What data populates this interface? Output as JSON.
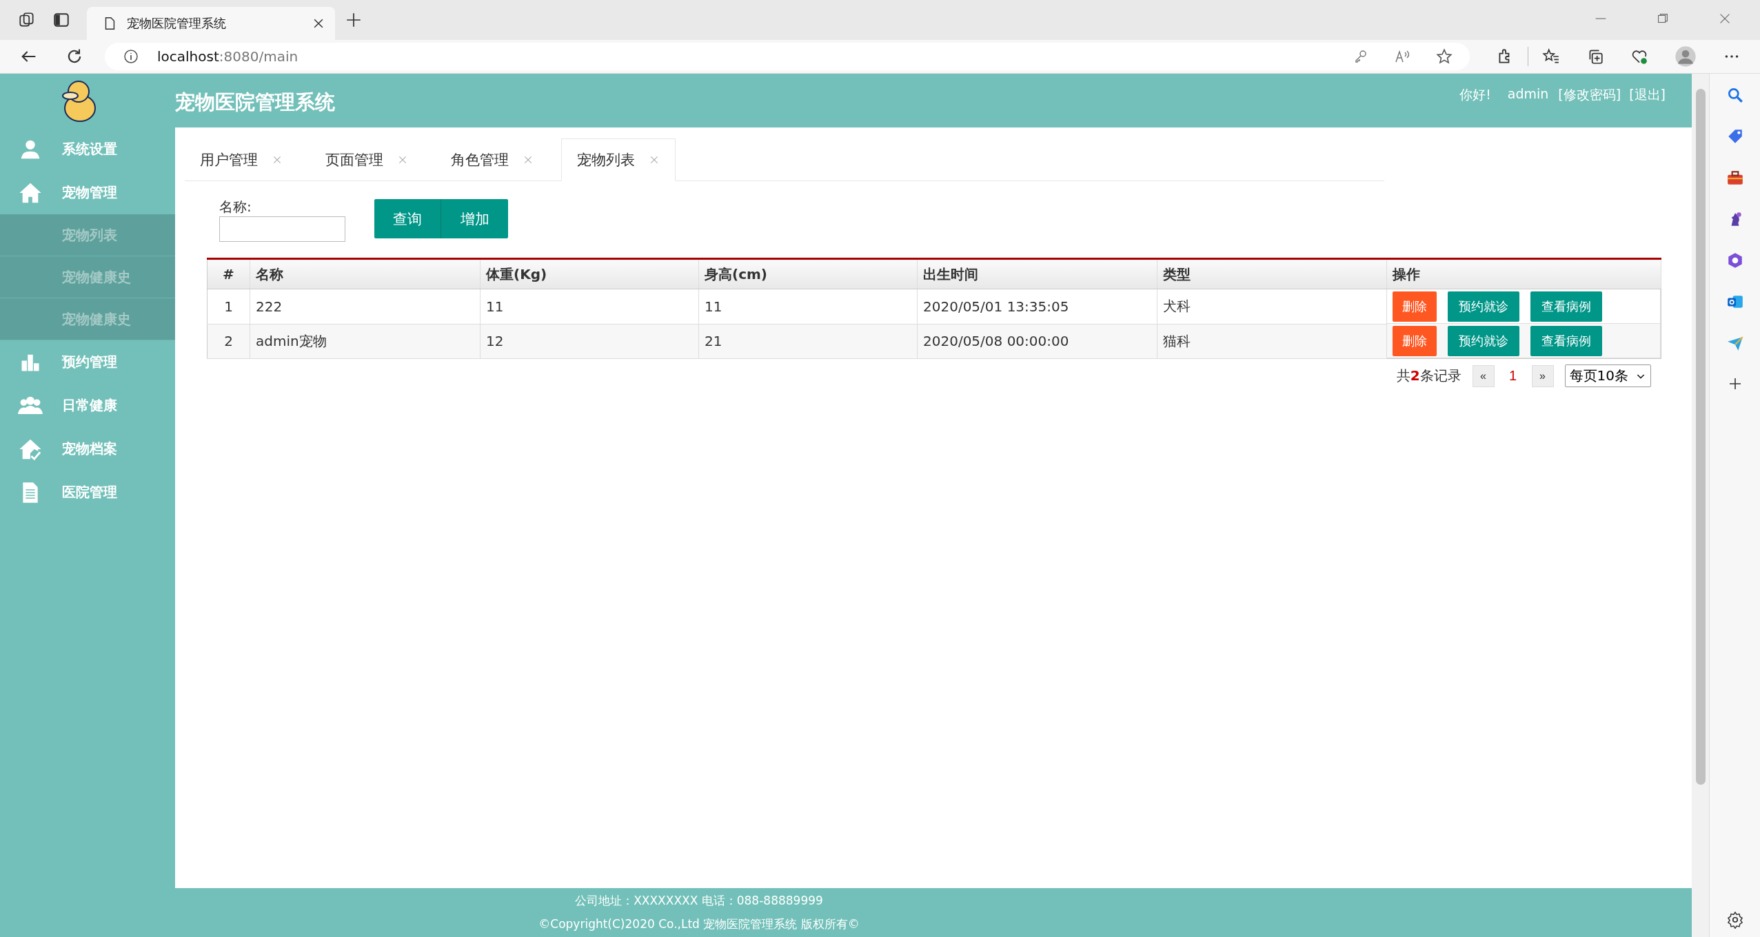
{
  "browser": {
    "tab_title": "宠物医院管理系统",
    "url_host": "localhost",
    "url_path": ":8080/main"
  },
  "header": {
    "title": "宠物医院管理系统",
    "greeting": "你好!",
    "user": "admin",
    "links": [
      "[修改密码]",
      "[退出]"
    ]
  },
  "sidebar": {
    "items": [
      {
        "label": "系统设置"
      },
      {
        "label": "宠物管理",
        "children": [
          {
            "label": "宠物列表"
          },
          {
            "label": "宠物健康史"
          },
          {
            "label": "宠物健康史"
          }
        ]
      },
      {
        "label": "预约管理"
      },
      {
        "label": "日常健康"
      },
      {
        "label": "宠物档案"
      },
      {
        "label": "医院管理"
      }
    ]
  },
  "tabs": [
    {
      "label": "用户管理",
      "selected": false
    },
    {
      "label": "页面管理",
      "selected": false
    },
    {
      "label": "角色管理",
      "selected": false
    },
    {
      "label": "宠物列表",
      "selected": true
    }
  ],
  "search": {
    "label": "名称:",
    "buttons": [
      "查询",
      "增加"
    ]
  },
  "table": {
    "columns": [
      "#",
      "名称",
      "体重(Kg)",
      "身高(cm)",
      "出生时间",
      "类型",
      "操作"
    ],
    "rows": [
      {
        "cells": [
          "1",
          "222",
          "11",
          "11",
          "2020/05/01 13:35:05",
          "犬科"
        ],
        "actions": [
          {
            "label": "删除",
            "kind": "danger"
          },
          {
            "label": "预约就诊",
            "kind": "primary"
          },
          {
            "label": "查看病例",
            "kind": "primary"
          }
        ]
      },
      {
        "cells": [
          "2",
          "admin宠物",
          "12",
          "21",
          "2020/05/08 00:00:00",
          "猫科"
        ],
        "actions": [
          {
            "label": "删除",
            "kind": "danger"
          },
          {
            "label": "预约就诊",
            "kind": "primary"
          },
          {
            "label": "查看病例",
            "kind": "primary"
          }
        ]
      }
    ]
  },
  "pagination": {
    "summary": "共**2**条记录",
    "prev": "«",
    "pages": [
      {
        "label": "1",
        "selected": true
      }
    ],
    "next": "»",
    "page_size": "每页10条"
  },
  "footer": {
    "lines": [
      "公司地址：XXXXXXXX 电话：088-88889999",
      "©Copyright(C)2020 Co.,Ltd 宠物医院管理系统 版权所有©"
    ]
  }
}
